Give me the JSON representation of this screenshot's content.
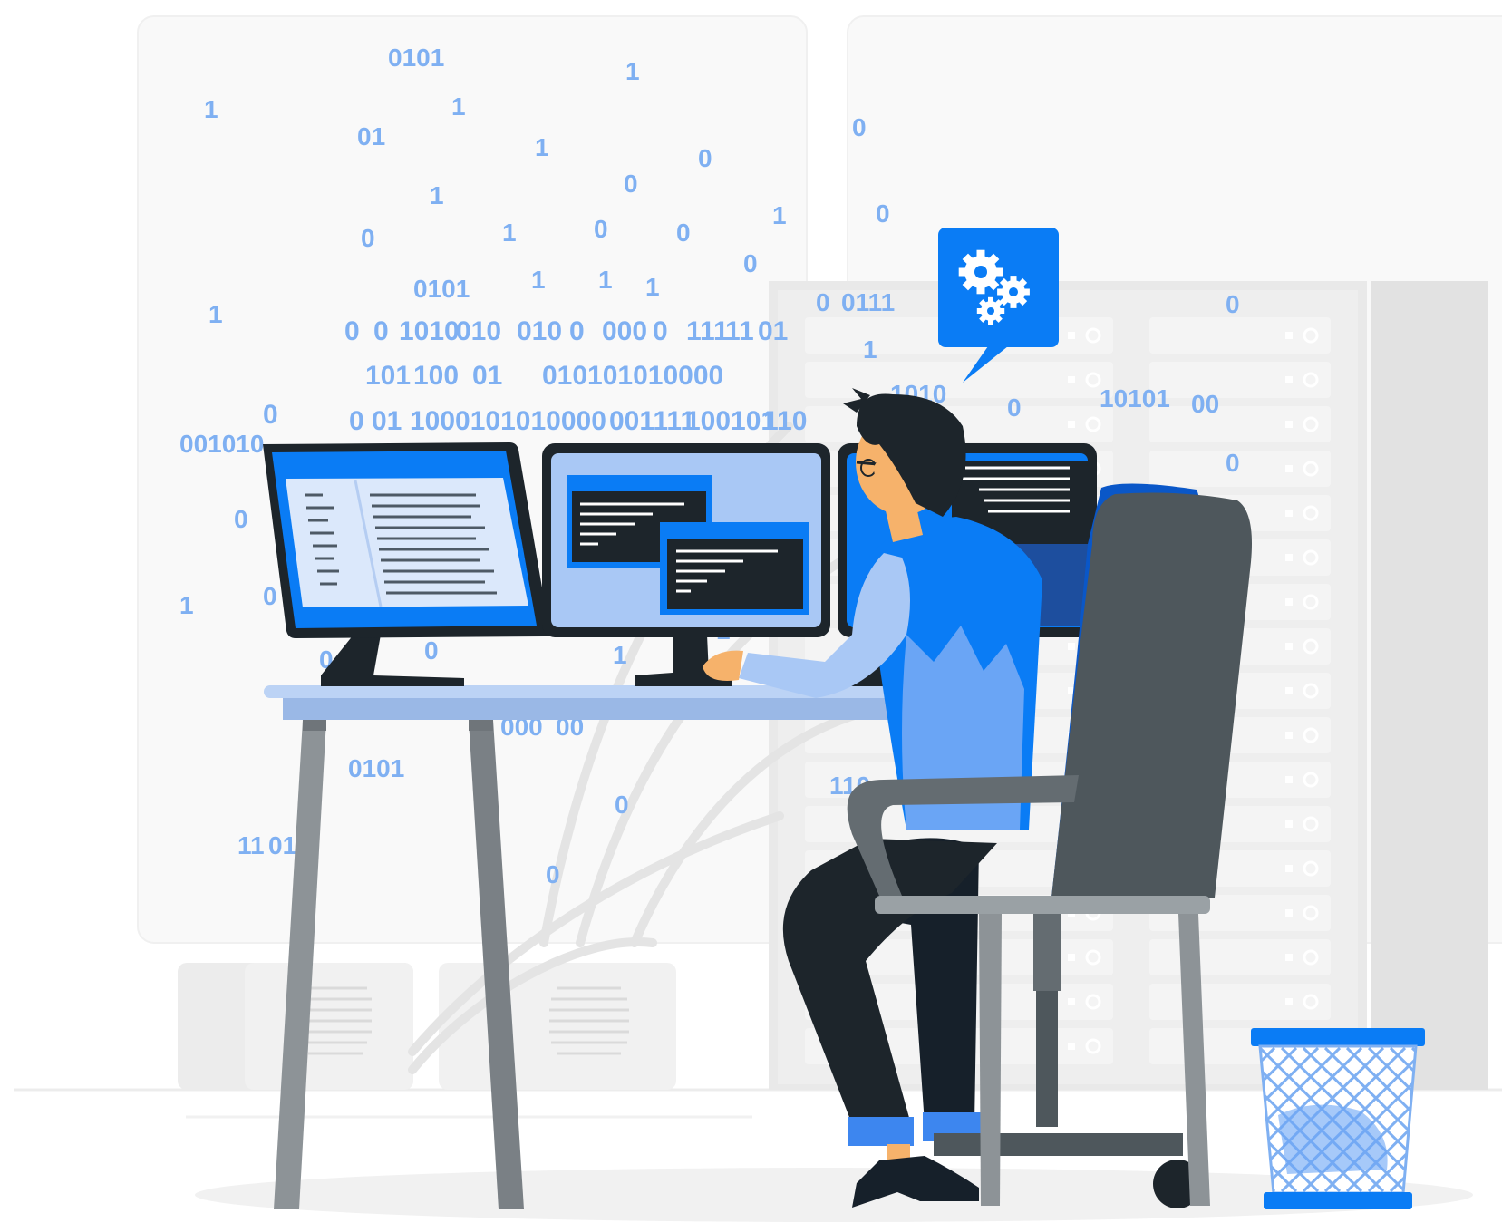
{
  "binary_strings": [
    "0101",
    "1",
    "1",
    "1",
    "01",
    "1",
    "0",
    "1",
    "0",
    "0",
    "1",
    "0",
    "0",
    "1",
    "0",
    "0",
    "0101",
    "1",
    "1",
    "1",
    "0",
    "1",
    "0",
    "0",
    "1010",
    "010",
    "010",
    "0",
    "000",
    "0",
    "111",
    "11",
    "01",
    "101",
    "100",
    "01",
    "010101010000",
    "0",
    "0",
    "01",
    "1000101010000",
    "001111",
    "100101",
    "110",
    "001010",
    "0",
    "1",
    "0",
    "0",
    "0",
    "1",
    "000",
    "00",
    "0101",
    "0",
    "11",
    "01",
    "0",
    "0",
    "0111",
    "1",
    "1010",
    "0",
    "10101",
    "00",
    "0",
    "0",
    "110",
    "1",
    "0",
    "1"
  ],
  "colors": {
    "brand_blue": "#0a7cf5",
    "light_blue": "#9cc3f7",
    "pale_blue": "#dbe8fb",
    "dark": "#1d252b",
    "chair_gray": "#4e575c",
    "rack_gray": "#ececec",
    "panel_gray": "#f7f7f7",
    "floor_shadow": "#f0f0f0"
  },
  "icons": {
    "speech_bubble": "gears-icon",
    "bin": "wastebasket-icon",
    "person": "developer-figure"
  }
}
